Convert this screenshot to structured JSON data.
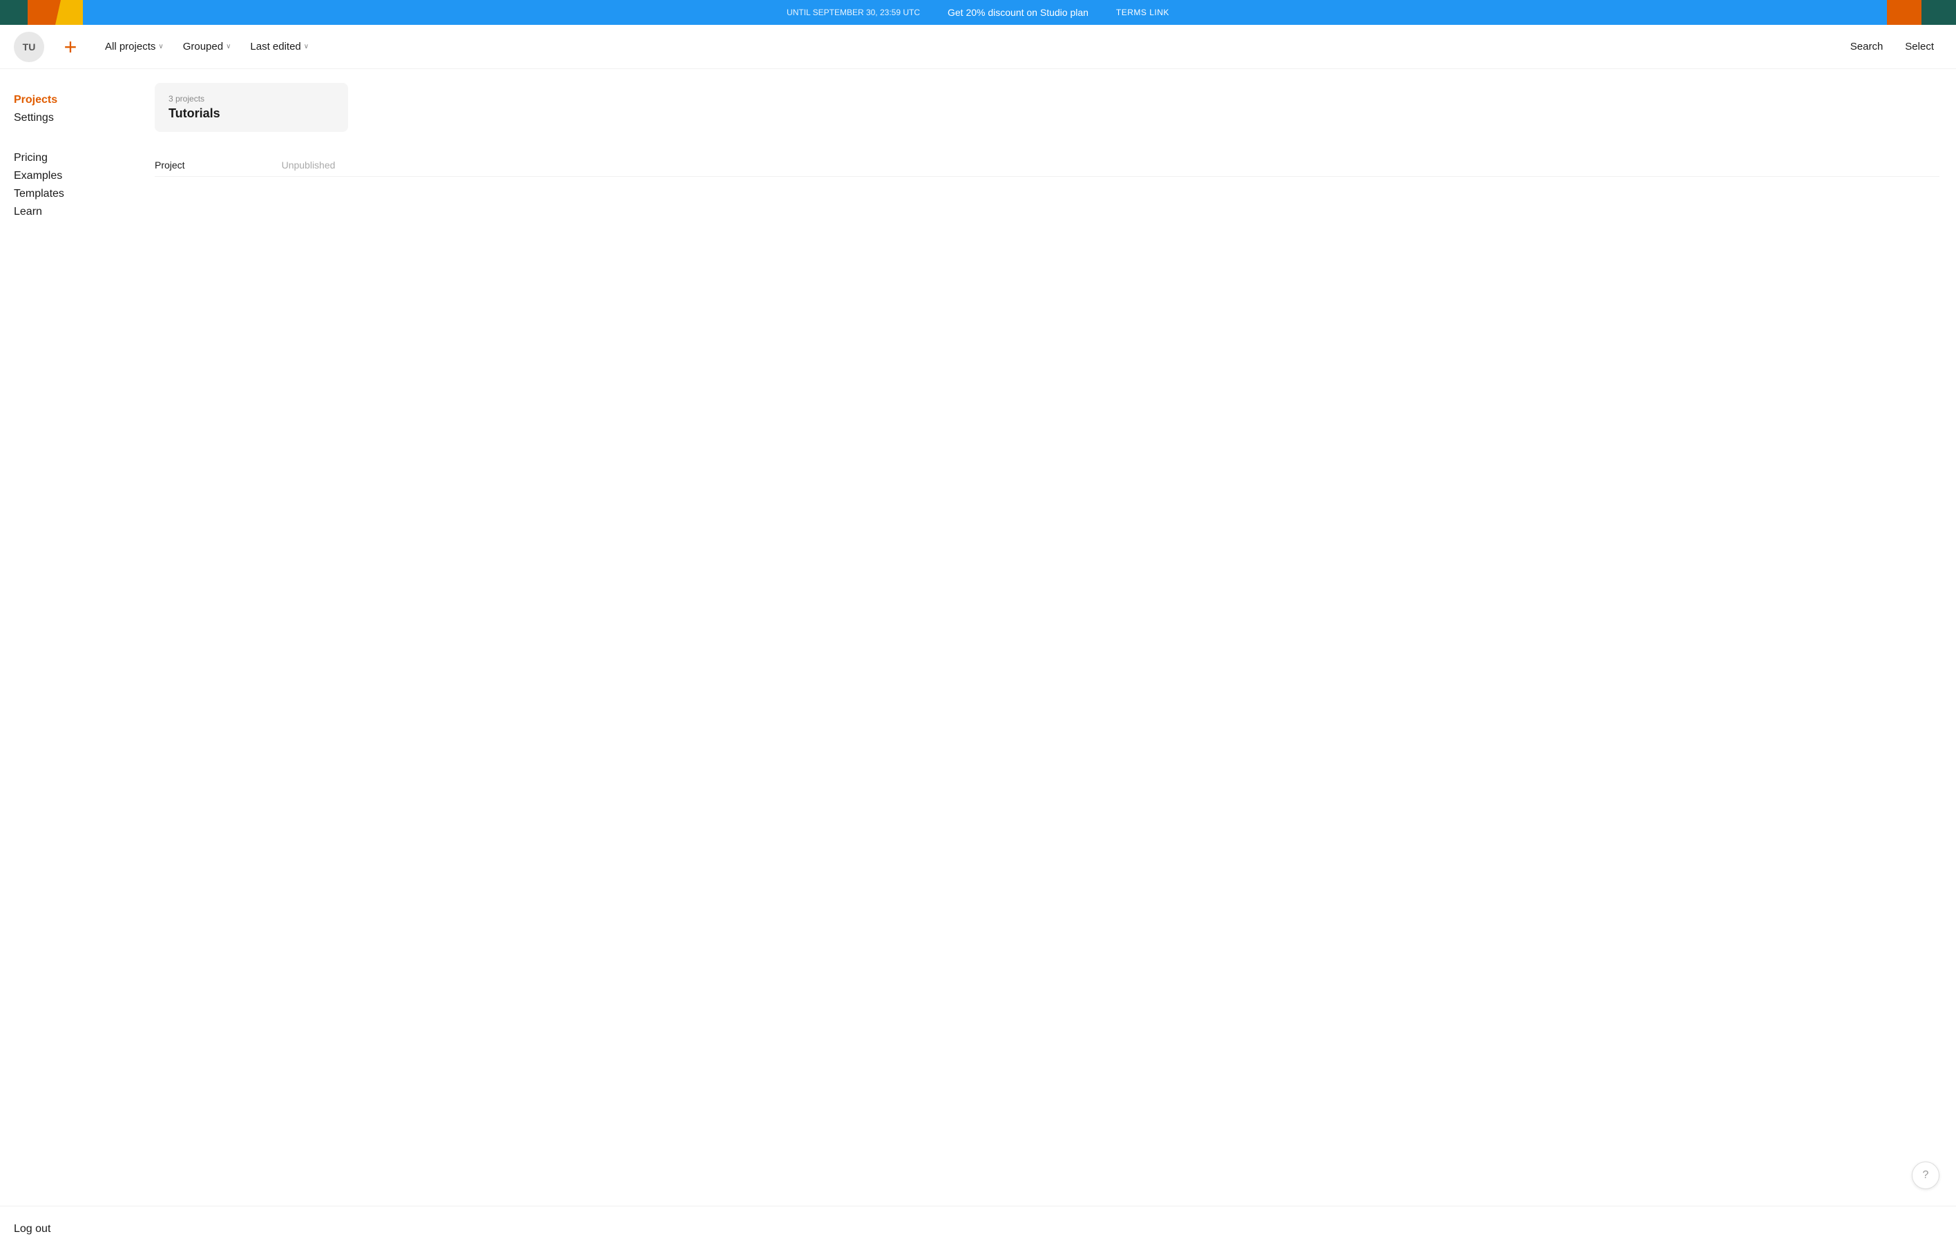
{
  "banner": {
    "until_text": "UNTIL SEPTEMBER 30, 23:59 UTC",
    "main_text": "Get 20% discount on Studio plan",
    "terms_text": "TERMS LINK",
    "bg_color": "#2196F3"
  },
  "header": {
    "avatar_initials": "TU",
    "new_project_label": "+",
    "nav": [
      {
        "label": "All projects",
        "has_chevron": true
      },
      {
        "label": "Grouped",
        "has_chevron": true
      },
      {
        "label": "Last edited",
        "has_chevron": true
      }
    ],
    "actions": [
      {
        "label": "Search"
      },
      {
        "label": "Select"
      }
    ]
  },
  "sidebar": {
    "items": [
      {
        "label": "Projects",
        "active": true
      },
      {
        "label": "Settings",
        "active": false
      }
    ],
    "links": [
      {
        "label": "Pricing"
      },
      {
        "label": "Examples"
      },
      {
        "label": "Templates"
      },
      {
        "label": "Learn"
      }
    ],
    "logout_label": "Log out"
  },
  "main": {
    "group": {
      "count_label": "3 projects",
      "name": "Tutorials"
    },
    "project_list": {
      "col_project": "Project",
      "col_status": "Unpublished"
    }
  },
  "help": {
    "icon": "?"
  }
}
